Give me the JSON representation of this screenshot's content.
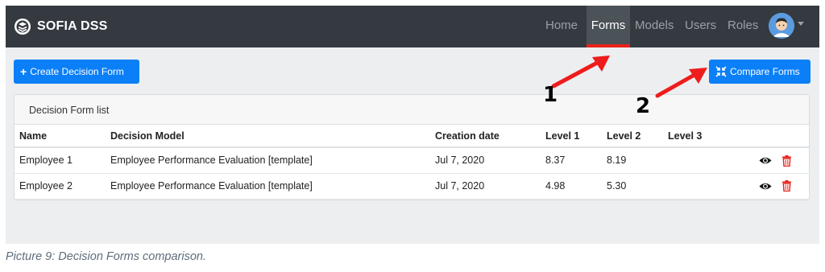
{
  "navbar": {
    "brand": "SOFIA DSS",
    "links": [
      {
        "label": "Home"
      },
      {
        "label": "Forms",
        "active": true
      },
      {
        "label": "Models"
      },
      {
        "label": "Users"
      },
      {
        "label": "Roles"
      }
    ],
    "active_color": "#e8221a"
  },
  "toolbar": {
    "create_icon": "plus-icon",
    "create_label": "Create Decision Form",
    "compare_icon": "compress-arrows-icon",
    "compare_label": "Compare Forms"
  },
  "card": {
    "title": "Decision Form list",
    "columns": [
      "Name",
      "Decision Model",
      "Creation date",
      "Level 1",
      "Level 2",
      "Level 3"
    ],
    "rows": [
      {
        "name": "Employee 1",
        "model": "Employee Performance Evaluation [template]",
        "date": "Jul 7, 2020",
        "level1": "8.37",
        "level2": "8.19",
        "level3": ""
      },
      {
        "name": "Employee 2",
        "model": "Employee Performance Evaluation [template]",
        "date": "Jul 7, 2020",
        "level1": "4.98",
        "level2": "5.30",
        "level3": ""
      }
    ],
    "row_actions": [
      "eye-icon",
      "trash-icon"
    ]
  },
  "annotations": {
    "marker_1": "1",
    "marker_2": "2",
    "arrow_color": "#ee1c1c"
  },
  "caption": "Picture 9: Decision Forms comparison.",
  "colors": {
    "navbar_bg": "#343a40",
    "primary": "#0b7ff7",
    "danger": "#e8221a"
  }
}
